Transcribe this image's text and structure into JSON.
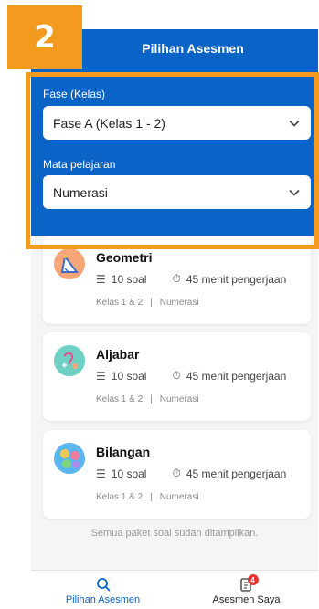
{
  "step_badge": "2",
  "header": {
    "title": "Pilihan Asesmen"
  },
  "filters": {
    "phase_label": "Fase (Kelas)",
    "phase_value": "Fase A (Kelas 1 - 2)",
    "subject_label": "Mata pelajaran",
    "subject_value": "Numerasi"
  },
  "cards": [
    {
      "title": "Geometri",
      "questions": "10 soal",
      "duration": "45 menit pengerjaan",
      "grade": "Kelas 1 & 2",
      "subject": "Numerasi",
      "icon": "geometry-icon"
    },
    {
      "title": "Aljabar",
      "questions": "10 soal",
      "duration": "45 menit pengerjaan",
      "grade": "Kelas 1 & 2",
      "subject": "Numerasi",
      "icon": "algebra-icon"
    },
    {
      "title": "Bilangan",
      "questions": "10 soal",
      "duration": "45 menit pengerjaan",
      "grade": "Kelas 1 & 2",
      "subject": "Numerasi",
      "icon": "numbers-icon"
    }
  ],
  "tag_separator": "|",
  "end_note": "Semua paket soal sudah ditampilkan.",
  "nav": {
    "items": [
      {
        "label": "Pilihan Asesmen",
        "icon": "search-icon",
        "active": true
      },
      {
        "label": "Asesmen Saya",
        "icon": "clipboard-icon",
        "badge": "4"
      }
    ]
  },
  "colors": {
    "primary": "#0A63C7",
    "accent": "#F39A1F",
    "badge": "#E53935"
  }
}
